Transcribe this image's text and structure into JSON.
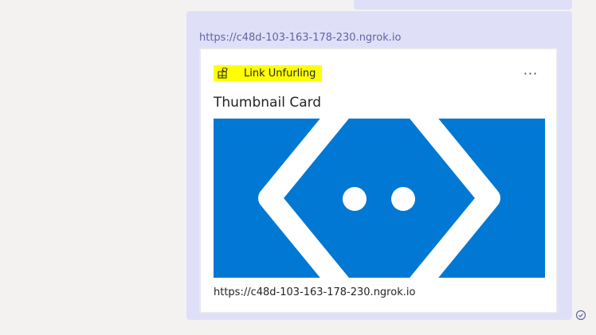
{
  "message": {
    "link_text": "https://c48d-103-163-178-230.ngrok.io",
    "card": {
      "app_name": "Link Unfurling",
      "more_label": "···",
      "title": "Thumbnail Card",
      "url": "https://c48d-103-163-178-230.ngrok.io",
      "thumbnail_icon": "azure-bot-service-icon",
      "thumbnail_bg": "#0078d4",
      "header_highlight": "#ffff00"
    },
    "status_icon": "read-receipt-check-icon"
  },
  "colors": {
    "bubble": "#dfdff8",
    "link": "#6264a7",
    "background": "#f3f2f1",
    "receipt": "#6264a7"
  }
}
